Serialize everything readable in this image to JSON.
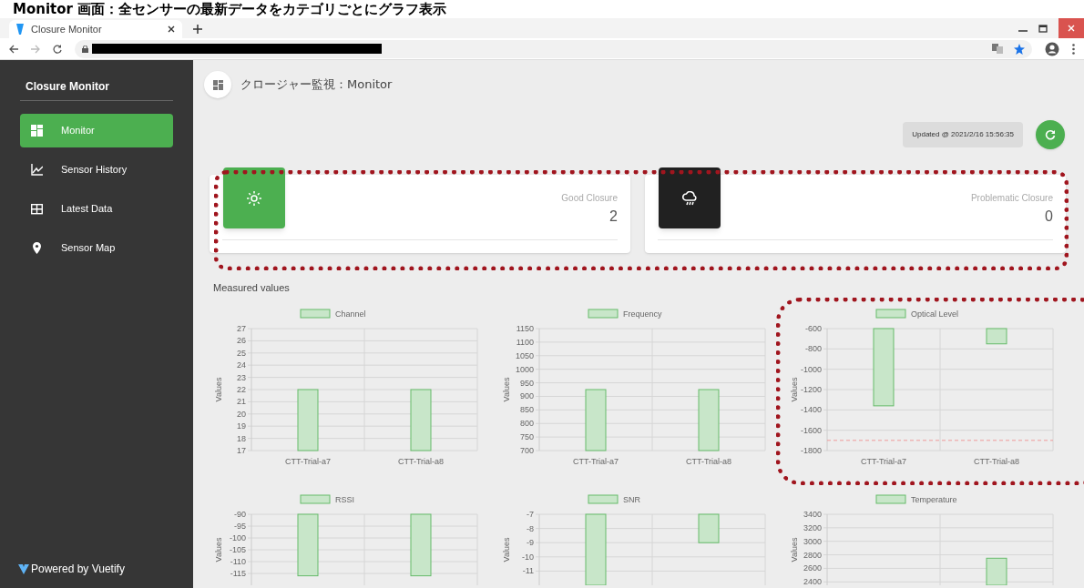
{
  "slide_title": "Monitor 画面：全センサーの最新データをカテゴリごとにグラフ表示",
  "browser": {
    "tab_title": "Closure Monitor"
  },
  "sidebar": {
    "title": "Closure Monitor",
    "items": [
      {
        "label": "Monitor",
        "kind": "dashboard",
        "selected": true
      },
      {
        "label": "Sensor History",
        "kind": "chart",
        "selected": false
      },
      {
        "label": "Latest Data",
        "kind": "table",
        "selected": false
      },
      {
        "label": "Sensor Map",
        "kind": "pin",
        "selected": false
      }
    ],
    "footer": "Powered by Vuetify"
  },
  "header": {
    "title": "クロージャー監視：Monitor"
  },
  "updated": "Updated @ 2021/2/16 15:56:35",
  "status_cards": [
    {
      "kind": "sun",
      "label": "Good Closure",
      "value": "2",
      "color": "#4caf50"
    },
    {
      "kind": "cloud-rain",
      "label": "Problematic Closure",
      "value": "0",
      "color": "#212121"
    }
  ],
  "section_title": "Measured values",
  "charts": [
    {
      "chart_data": {
        "type": "bar",
        "ylabel": "Values",
        "categories": [
          "CTT-Trial-a7",
          "CTT-Trial-a8"
        ],
        "grid": true,
        "series": [
          {
            "name": "Channel",
            "color": "#c8e6c9",
            "values": [
              22,
              22
            ]
          }
        ],
        "ylim": [
          17,
          27
        ],
        "yticks": [
          17,
          18,
          19,
          20,
          21,
          22,
          23,
          24,
          25,
          26,
          27
        ]
      }
    },
    {
      "chart_data": {
        "type": "bar",
        "ylabel": "Values",
        "categories": [
          "CTT-Trial-a7",
          "CTT-Trial-a8"
        ],
        "grid": true,
        "series": [
          {
            "name": "Frequency",
            "color": "#c8e6c9",
            "values": [
              925,
              925
            ]
          }
        ],
        "ylim": [
          700,
          1150
        ],
        "yticks": [
          700,
          750,
          800,
          850,
          900,
          950,
          1000,
          1050,
          1100,
          1150
        ]
      }
    },
    {
      "chart_data": {
        "type": "bar",
        "ylabel": "Values",
        "categories": [
          "CTT-Trial-a7",
          "CTT-Trial-a8"
        ],
        "grid": true,
        "series": [
          {
            "name": "Optical Level",
            "color": "#c8e6c9",
            "values": [
              -1360,
              -750
            ]
          }
        ],
        "ylim": [
          -1800,
          -600
        ],
        "yticks": [
          -1800,
          -1600,
          -1400,
          -1200,
          -1000,
          -800,
          -600
        ],
        "ref_lines": [
          {
            "axis": "y",
            "value": -1700
          }
        ]
      }
    },
    {
      "chart_data": {
        "type": "bar",
        "ylabel": "Values",
        "grid": true,
        "series": [
          {
            "name": "RSSI",
            "color": "#c8e6c9",
            "values": [
              -116,
              -116
            ]
          }
        ],
        "ylim": [
          -120,
          -90
        ],
        "yticks": [
          -115,
          -110,
          -105,
          -100,
          -95,
          -90
        ]
      }
    },
    {
      "chart_data": {
        "type": "bar",
        "ylabel": "Values",
        "grid": true,
        "series": [
          {
            "name": "SNR",
            "color": "#c8e6c9",
            "values": [
              -12,
              -9
            ]
          }
        ],
        "ylim": [
          -12,
          -7
        ],
        "yticks": [
          -11,
          -10,
          -9,
          -8,
          -7
        ]
      }
    },
    {
      "chart_data": {
        "type": "bar",
        "ylabel": "Values",
        "grid": true,
        "series": [
          {
            "name": "Temperature",
            "color": "#c8e6c9",
            "values": [
              null,
              2750
            ]
          }
        ],
        "ylim": [
          2350,
          3400
        ],
        "yticks": [
          2400,
          2600,
          2800,
          3000,
          3200,
          3400
        ]
      }
    }
  ]
}
